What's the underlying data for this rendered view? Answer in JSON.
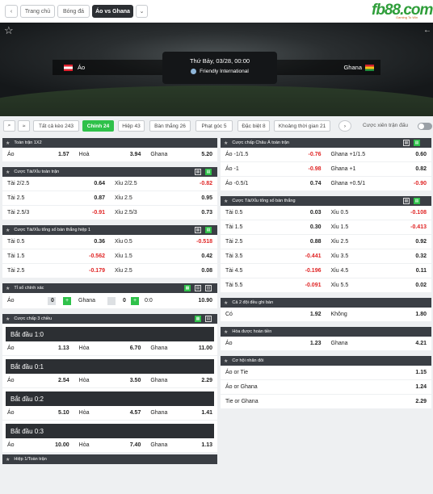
{
  "nav": {
    "tabs": [
      "Trang chủ",
      "Bóng đá",
      "Áo vs Ghana"
    ]
  },
  "logo": {
    "text": "fb88.com",
    "tagline": "Gaming To Win"
  },
  "match": {
    "home": "Áo",
    "away": "Ghana",
    "datetime": "Thứ Bảy, 03/28, 00:00",
    "league": "Friendly International"
  },
  "filters": [
    "Tất cả kèo 243",
    "Chính 24",
    "Hiệp 43",
    "Bàn thắng 26",
    "Phạt góc 5",
    "Đặc biệt 8",
    "Khoảng thời gian 21"
  ],
  "filter_active": "Chính 24",
  "parlay_label": "Cược xiên trận đấu",
  "left_markets": [
    {
      "title": "Toàn trận 1X2",
      "rows": [
        [
          [
            "Áo",
            "1.57"
          ],
          [
            "Hoà",
            "3.94"
          ],
          [
            "Ghana",
            "5.20"
          ]
        ]
      ]
    },
    {
      "title": "Cược Tài/Xỉu toàn trận",
      "rows": [
        [
          [
            "Tài 2/2.5",
            "0.64"
          ],
          [
            "Xỉu 2/2.5",
            "-0.82"
          ]
        ],
        [
          [
            "Tài 2.5",
            "0.87"
          ],
          [
            "Xỉu 2.5",
            "0.95"
          ]
        ],
        [
          [
            "Tài 2.5/3",
            "-0.91"
          ],
          [
            "Xỉu 2.5/3",
            "0.73"
          ]
        ]
      ]
    },
    {
      "title": "Cược Tài/Xỉu tổng số bàn thắng hiệp 1",
      "rows": [
        [
          [
            "Tài 0.5",
            "0.36"
          ],
          [
            "Xỉu 0.5",
            "-0.518"
          ]
        ],
        [
          [
            "Tài 1.5",
            "-0.562"
          ],
          [
            "Xỉu 1.5",
            "0.42"
          ]
        ],
        [
          [
            "Tài 2.5",
            "-0.179"
          ],
          [
            "Xỉu 2.5",
            "0.08"
          ]
        ]
      ]
    },
    {
      "title": "Tỉ số chính xác",
      "correct_score": {
        "home": "Áo",
        "home_val": "0",
        "away": "Ghana",
        "away_val": "0",
        "score": "0:0",
        "odds": "10.90"
      }
    },
    {
      "title": "Cược chấp 3 chiều",
      "groups": [
        {
          "label": "Bắt đầu 1:0",
          "row": [
            [
              "Áo",
              "1.13"
            ],
            [
              "Hòa",
              "6.70"
            ],
            [
              "Ghana",
              "11.00"
            ]
          ]
        },
        {
          "label": "Bắt đầu 0:1",
          "row": [
            [
              "Áo",
              "2.54"
            ],
            [
              "Hòa",
              "3.50"
            ],
            [
              "Ghana",
              "2.29"
            ]
          ]
        },
        {
          "label": "Bắt đầu 0:2",
          "row": [
            [
              "Áo",
              "5.10"
            ],
            [
              "Hòa",
              "4.57"
            ],
            [
              "Ghana",
              "1.41"
            ]
          ]
        },
        {
          "label": "Bắt đầu 0:3",
          "row": [
            [
              "Áo",
              "10.00"
            ],
            [
              "Hòa",
              "7.40"
            ],
            [
              "Ghana",
              "1.13"
            ]
          ]
        }
      ]
    },
    {
      "title": "Hiệp 1/Toàn trận"
    }
  ],
  "right_markets": [
    {
      "title": "Cược chấp Châu Á toàn trận",
      "rows": [
        [
          [
            "Áo -1/1.5",
            "-0.76"
          ],
          [
            "Ghana +1/1.5",
            "0.60"
          ]
        ],
        [
          [
            "Áo -1",
            "-0.98"
          ],
          [
            "Ghana +1",
            "0.82"
          ]
        ],
        [
          [
            "Áo -0.5/1",
            "0.74"
          ],
          [
            "Ghana +0.5/1",
            "-0.90"
          ]
        ]
      ]
    },
    {
      "title": "Cược Tài/Xỉu tổng số bàn thắng",
      "rows": [
        [
          [
            "Tài 0.5",
            "0.03"
          ],
          [
            "Xỉu 0.5",
            "-0.108"
          ]
        ],
        [
          [
            "Tài 1.5",
            "0.30"
          ],
          [
            "Xỉu 1.5",
            "-0.413"
          ]
        ],
        [
          [
            "Tài 2.5",
            "0.88"
          ],
          [
            "Xỉu 2.5",
            "0.92"
          ]
        ],
        [
          [
            "Tài 3.5",
            "-0.441"
          ],
          [
            "Xỉu 3.5",
            "0.32"
          ]
        ],
        [
          [
            "Tài 4.5",
            "-0.196"
          ],
          [
            "Xỉu 4.5",
            "0.11"
          ]
        ],
        [
          [
            "Tài 5.5",
            "-0.091"
          ],
          [
            "Xỉu 5.5",
            "0.02"
          ]
        ]
      ]
    },
    {
      "title": "Cả 2 đội đều ghi bàn",
      "rows": [
        [
          [
            "Có",
            "1.92"
          ],
          [
            "Không",
            "1.80"
          ]
        ]
      ]
    },
    {
      "title": "Hòa được hoàn tiền",
      "rows": [
        [
          [
            "Áo",
            "1.23"
          ],
          [
            "Ghana",
            "4.21"
          ]
        ]
      ]
    },
    {
      "title": "Cơ hội nhân đôi",
      "rows": [
        [
          [
            "Áo or Tie",
            "1.15"
          ]
        ],
        [
          [
            "Áo or Ghana",
            "1.24"
          ]
        ],
        [
          [
            "Tie or Ghana",
            "2.29"
          ]
        ]
      ]
    }
  ]
}
